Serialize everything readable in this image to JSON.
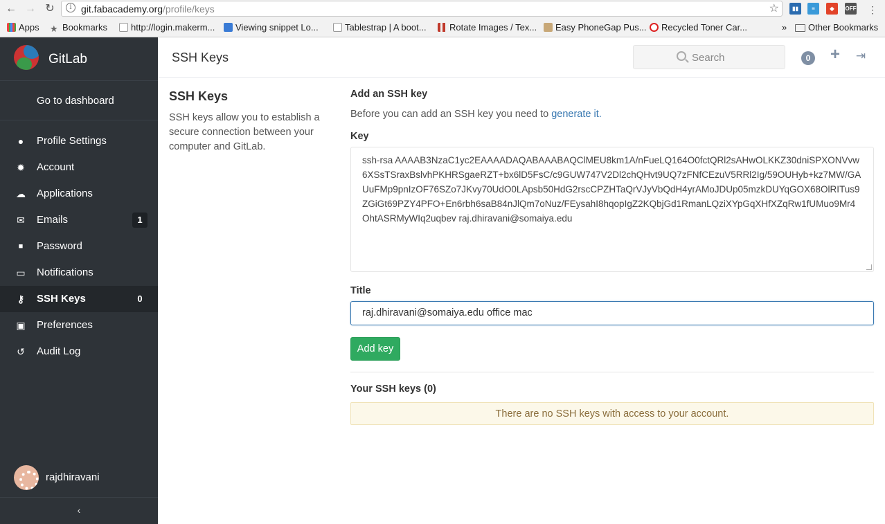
{
  "browser": {
    "url_host": "git.fabacademy.org",
    "url_path": "/profile/keys",
    "bookmarks": [
      {
        "label": "Apps",
        "color": "#e44"
      },
      {
        "label": "Bookmarks",
        "color": "#666"
      },
      {
        "label": "http://login.makerm...",
        "color": "#999"
      },
      {
        "label": "Viewing snippet Lo...",
        "color": "#3a7bd5"
      },
      {
        "label": "Tablestrap | A boot...",
        "color": "#999"
      },
      {
        "label": "Rotate Images / Tex...",
        "color": "#c0392b"
      },
      {
        "label": "Easy PhoneGap Pus...",
        "color": "#c8a878"
      },
      {
        "label": "Recycled Toner Car...",
        "color": "#d22"
      }
    ],
    "more": "»",
    "other_bookmarks": "Other Bookmarks"
  },
  "sidebar": {
    "brand": "GitLab",
    "back_link": "Go to dashboard",
    "items": [
      {
        "label": "Profile Settings",
        "icon": "user-icon",
        "glyph": "●",
        "count": "",
        "active": false
      },
      {
        "label": "Account",
        "icon": "gear-icon",
        "glyph": "✹",
        "count": "",
        "active": false
      },
      {
        "label": "Applications",
        "icon": "cloud-icon",
        "glyph": "☁",
        "count": "",
        "active": false
      },
      {
        "label": "Emails",
        "icon": "envelope-icon",
        "glyph": "✉",
        "count": "1",
        "active": false
      },
      {
        "label": "Password",
        "icon": "lock-icon",
        "glyph": "🔒",
        "count": "",
        "active": false
      },
      {
        "label": "Notifications",
        "icon": "inbox-icon",
        "glyph": "▭",
        "count": "",
        "active": false
      },
      {
        "label": "SSH Keys",
        "icon": "key-icon",
        "glyph": "⚷",
        "count": "0",
        "active": true
      },
      {
        "label": "Preferences",
        "icon": "image-icon",
        "glyph": "▣",
        "count": "",
        "active": false
      },
      {
        "label": "Audit Log",
        "icon": "history-icon",
        "glyph": "↺",
        "count": "",
        "active": false
      }
    ],
    "username": "rajdhiravani",
    "collapse_glyph": "‹"
  },
  "header": {
    "title": "SSH Keys",
    "search_placeholder": "Search",
    "todo_count": "0"
  },
  "intro": {
    "title": "SSH Keys",
    "description": "SSH keys allow you to establish a secure connection between your computer and GitLab."
  },
  "form": {
    "heading": "Add an SSH key",
    "help_prefix": "Before you can add an SSH key you need to ",
    "help_link": "generate it.",
    "key_label": "Key",
    "key_value": "ssh-rsa AAAAB3NzaC1yc2EAAAADAQABAAABAQClMEU8km1A/nFueLQ164O0fctQRl2sAHwOLKKZ30dniSPXONVvw6XSsTSraxBslvhPKHRSgaeRZT+bx6lD5FsC/c9GUW747V2Dl2chQHvt9UQ7zFNfCEzuV5RRl2Ig/59OUHyb+kz7MW/GAUuFMp9pnIzOF76SZo7JKvy70UdO0LApsb50HdG2rscCPZHTaQrVJyVbQdH4yrAMoJDUp05mzkDUYqGOX68OlRITus9ZGiGt69PZY4PFO+En6rbh6saB84nJlQm7oNuz/FEysahI8hqopIgZ2KQbjGd1RmanLQziXYpGqXHfXZqRw1fUMuo9Mr4OhtASRMyWIq2uqbev raj.dhiravani@somaiya.edu",
    "title_label": "Title",
    "title_value": "raj.dhiravani@somaiya.edu office mac",
    "submit_label": "Add key"
  },
  "keys": {
    "heading": "Your SSH keys (0)",
    "empty_message": "There are no SSH keys with access to your account."
  },
  "colors": {
    "sidebar_bg": "#2e3338",
    "accent_link": "#3777b0",
    "button_green": "#2faa60",
    "warning_bg": "#fcf8e9"
  }
}
